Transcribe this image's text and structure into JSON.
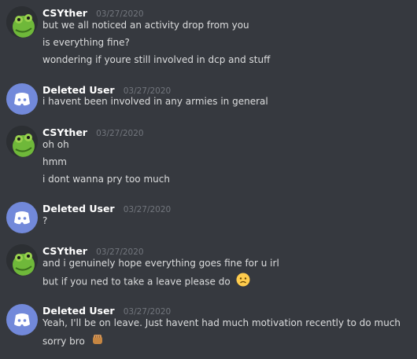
{
  "messages": [
    {
      "author": "CSYther",
      "timestamp": "03/27/2020",
      "avatar": "green-frog-avatar",
      "lines": [
        "but we all noticed an activity drop from you",
        "is everything fine?",
        "wondering if youre still involved in dcp and stuff"
      ]
    },
    {
      "author": "Deleted User",
      "timestamp": "03/27/2020",
      "avatar": "discord-default-avatar",
      "lines": [
        "i havent been involved in any armies in general"
      ]
    },
    {
      "author": "CSYther",
      "timestamp": "03/27/2020",
      "avatar": "green-frog-avatar",
      "lines": [
        "oh oh",
        "hmm",
        "i dont wanna pry too much"
      ]
    },
    {
      "author": "Deleted User",
      "timestamp": "03/27/2020",
      "avatar": "discord-default-avatar",
      "lines": [
        "?"
      ]
    },
    {
      "author": "CSYther",
      "timestamp": "03/27/2020",
      "avatar": "green-frog-avatar",
      "lines": [
        "and i genuinely hope everything goes fine for u irl",
        "but if you ned to take a leave please do"
      ],
      "emoji": "frowning-face-emoji"
    },
    {
      "author": "Deleted User",
      "timestamp": "03/27/2020",
      "avatar": "discord-default-avatar",
      "lines": [
        "Yeah, I'll be on leave. Just havent had much motivation recently to do much",
        "sorry bro"
      ],
      "emoji": "fist-bump-emoji"
    }
  ],
  "colors": {
    "background": "#36393f",
    "username": "#ffffff",
    "timestamp": "#72767d",
    "text": "#dcddde",
    "discord_blurple": "#7289da"
  }
}
